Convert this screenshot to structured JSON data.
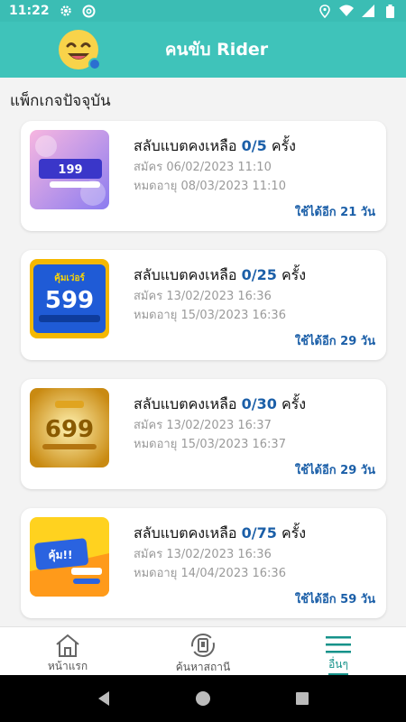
{
  "status_bar": {
    "time": "11:22",
    "icons": [
      "gear-icon",
      "at-icon",
      "location-icon",
      "wifi-icon",
      "signal-icon",
      "battery-icon"
    ]
  },
  "app_bar": {
    "title": "คนขับ Rider",
    "avatar_icon": "smiley-face-icon"
  },
  "section_title": "แพ็กเกจปัจจุบัน",
  "packages": [
    {
      "prefix": "สลับแบตคงเหลือ ",
      "count": "0/5",
      "suffix": " ครั้ง",
      "subscribed": "สมัคร 06/02/2023 11:10",
      "expires": "หมดอายุ 08/03/2023 11:10",
      "remaining": "ใช้ได้อีก 21 วัน",
      "thumb_text": "ลองดู 199"
    },
    {
      "prefix": "สลับแบตคงเหลือ ",
      "count": "0/25",
      "suffix": " ครั้ง",
      "subscribed": "สมัคร 13/02/2023 16:36",
      "expires": "หมดอายุ 15/03/2023 16:36",
      "remaining": "ใช้ได้อีก 29 วัน",
      "thumb_text": "คุ้มเว่อร์ 599"
    },
    {
      "prefix": "สลับแบตคงเหลือ ",
      "count": "0/30",
      "suffix": " ครั้ง",
      "subscribed": "สมัคร 13/02/2023 16:37",
      "expires": "หมดอายุ 15/03/2023 16:37",
      "remaining": "ใช้ได้อีก 29 วัน",
      "thumb_text": "699"
    },
    {
      "prefix": "สลับแบตคงเหลือ ",
      "count": "0/75",
      "suffix": " ครั้ง",
      "subscribed": "สมัคร 13/02/2023 16:36",
      "expires": "หมดอายุ 14/04/2023 16:36",
      "remaining": "ใช้ได้อีก 59 วัน",
      "thumb_text": "คุ้ม!! หนักมาก"
    }
  ],
  "bottom_nav": [
    {
      "label": "หน้าแรก",
      "icon": "home-icon"
    },
    {
      "label": "ค้นหาสถานี",
      "icon": "station-search-icon"
    },
    {
      "label": "อื่นๆ",
      "icon": "menu-icon"
    }
  ],
  "colors": {
    "primary": "#3fc3ba",
    "accent_blue": "#1b5fa8",
    "active_nav": "#16928a"
  }
}
